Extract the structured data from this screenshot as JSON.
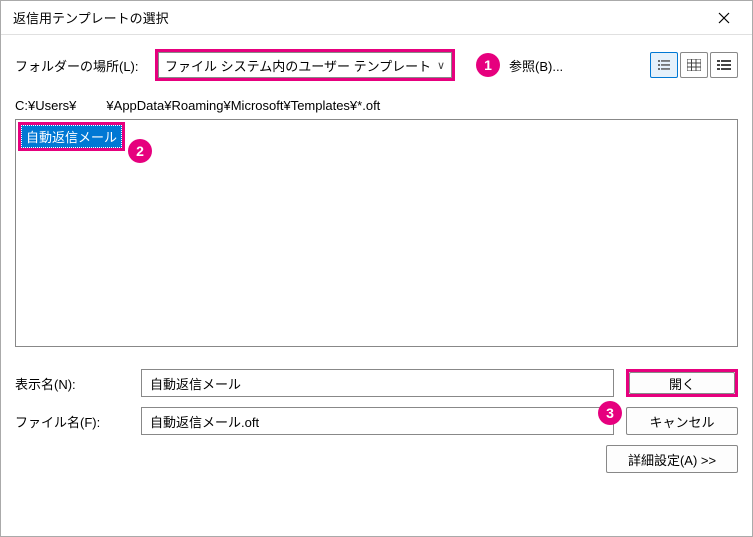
{
  "dialog": {
    "title": "返信用テンプレートの選択",
    "folder_label": "フォルダーの場所(L):",
    "folder_value": "ファイル システム内のユーザー テンプレート",
    "browse_label": "参照(B)...",
    "path_prefix": "C:¥Users¥",
    "path_suffix": "¥AppData¥Roaming¥Microsoft¥Templates¥*.oft",
    "file_item": "自動返信メール",
    "display_name_label": "表示名(N):",
    "display_name_value": "自動返信メール",
    "file_name_label": "ファイル名(F):",
    "file_name_value": "自動返信メール.oft",
    "open_label": "開く",
    "cancel_label": "キャンセル",
    "advanced_label": "詳細設定(A) >>"
  },
  "annotations": {
    "b1": "1",
    "b2": "2",
    "b3": "3"
  },
  "icons": {
    "view1": "⠿",
    "view2": "▥",
    "view3": "☱"
  }
}
